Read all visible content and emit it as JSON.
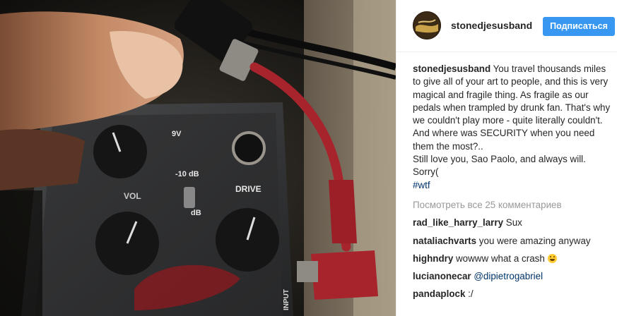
{
  "post": {
    "username": "stonedjesusband",
    "follow_label": "Подписаться",
    "caption_lines": [
      "You travel thousands miles to give all of your art to people, and this is very magical and fragile thing. As fragile as our pedals when trampled by drunk fan. That's why we couldn't play more - quite literally couldn't. And where was SECURITY when you need them the most?..",
      "Still love you, Sao Paolo, and always will.",
      "Sorry("
    ],
    "hashtag": "#wtf",
    "view_all": "Посмотреть все 25 комментариев"
  },
  "comments": [
    {
      "user": "rad_like_harry_larry",
      "text": "Sux",
      "mention": ""
    },
    {
      "user": "nataliachvarts",
      "text": "you were amazing anyway",
      "mention": ""
    },
    {
      "user": "highndry",
      "text": "wowww what a crash",
      "mention": "",
      "emoji": "grinning-face"
    },
    {
      "user": "lucianonecar",
      "text": "",
      "mention": "@dipietrogabriel"
    },
    {
      "user": "pandaplock",
      "text": ":/",
      "mention": ""
    }
  ],
  "photo": {
    "pedal_labels": [
      "9V",
      "-10 dB",
      "dB",
      "DRIVE",
      "VOL",
      "INPUT"
    ],
    "colors": {
      "pedal_body": "#2f3031",
      "cable": "#a8242d",
      "knob": "#151515"
    }
  },
  "colors": {
    "accent": "#3897f0",
    "link": "#003569",
    "muted": "#999999",
    "text": "#262626"
  }
}
